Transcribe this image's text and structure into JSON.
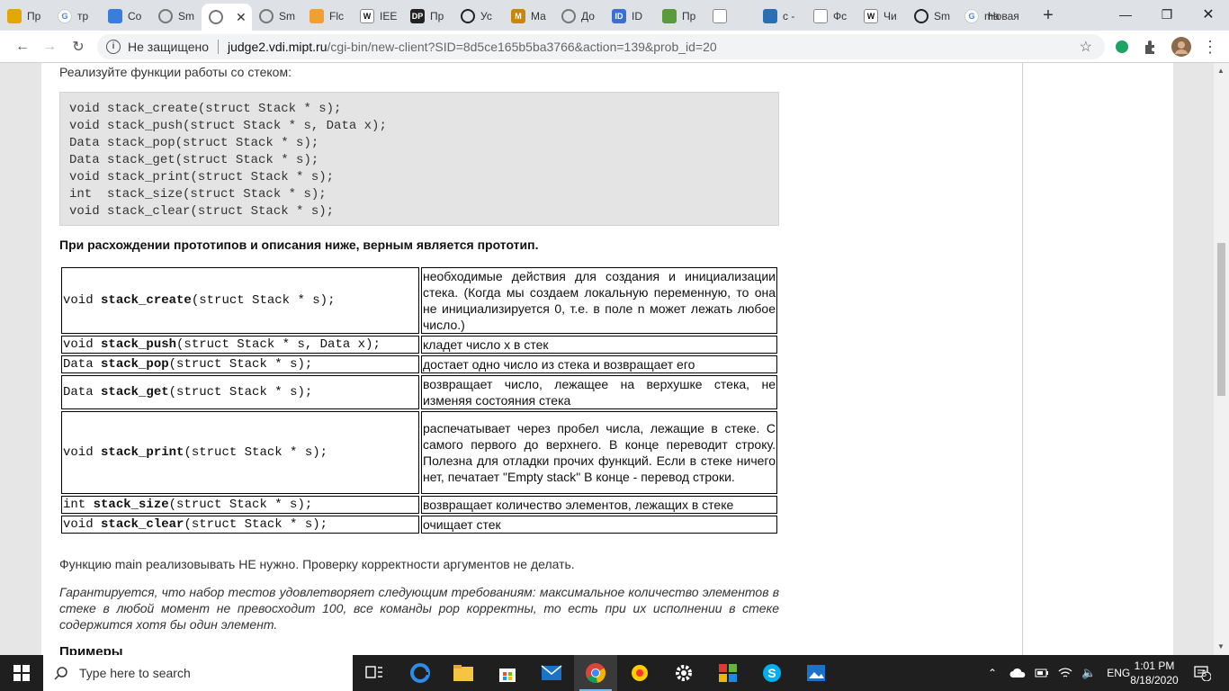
{
  "tabs": [
    {
      "label": "Пр",
      "icon": "yellow-page-icon",
      "color": "#e0a800"
    },
    {
      "label": "тр",
      "icon": "google-icon",
      "color": "#4285f4"
    },
    {
      "label": "Co",
      "icon": "chat-icon",
      "color": "#3b7ddd"
    },
    {
      "label": "Sm",
      "icon": "globe-icon",
      "color": "#777777"
    },
    {
      "label": "",
      "icon": "globe-icon",
      "color": "#777777",
      "active": true
    },
    {
      "label": "Sm",
      "icon": "globe-icon",
      "color": "#777777"
    },
    {
      "label": "Flc",
      "icon": "flowchart-icon",
      "color": "#f0a030"
    },
    {
      "label": "IEE",
      "icon": "wikipedia-icon",
      "color": "#222222"
    },
    {
      "label": "Пр",
      "icon": "dp-icon",
      "color": "#222222"
    },
    {
      "label": "Ус",
      "icon": "globe-icon",
      "color": "#222222"
    },
    {
      "label": "Ма",
      "icon": "m-icon",
      "color": "#c8860a"
    },
    {
      "label": "До",
      "icon": "globe-icon",
      "color": "#777777"
    },
    {
      "label": "ID",
      "icon": "id-icon",
      "color": "#3b6fd0"
    },
    {
      "label": "Пр",
      "icon": "book-icon",
      "color": "#5a9a3a"
    },
    {
      "label": "",
      "icon": "doc-icon",
      "color": "#444444"
    },
    {
      "label": "с -",
      "icon": "stack-icon",
      "color": "#2a6fb5"
    },
    {
      "label": "Фс",
      "icon": "doc-icon",
      "color": "#444444"
    },
    {
      "label": "Чи",
      "icon": "wikipedia-icon",
      "color": "#222222"
    },
    {
      "label": "Sm",
      "icon": "globe-icon",
      "color": "#222222"
    },
    {
      "label": "ma",
      "icon": "google-icon",
      "color": "#4285f4"
    },
    {
      "label": "Новая",
      "icon": "",
      "color": ""
    }
  ],
  "address": {
    "insecure_label": "Не защищено",
    "host": "judge2.vdi.mipt.ru",
    "path": "/cgi-bin/new-client?SID=8d5ce165b5ba3766&action=139&prob_id=20"
  },
  "page": {
    "intro": "Реализуйте функции работы со стеком:",
    "code_lines": [
      "void stack_create(struct Stack * s);",
      "void stack_push(struct Stack * s, Data x);",
      "Data stack_pop(struct Stack * s);",
      "Data stack_get(struct Stack * s);",
      "void stack_print(struct Stack * s);",
      "int  stack_size(struct Stack * s);",
      "void stack_clear(struct Stack * s);"
    ],
    "note": "При расхождении прототипов и описания ниже, верным является прототип.",
    "functions": [
      {
        "ret": "void ",
        "name": "stack_create",
        "args": "(struct Stack * s);",
        "desc": "необходимые действия для создания и инициализации стека. (Когда мы создаем локальную переменную, то она не инициализируется 0, т.е. в поле n может лежать любое число.)"
      },
      {
        "ret": "void ",
        "name": "stack_push",
        "args": "(struct Stack * s, Data x);",
        "desc": "кладет число x в стек"
      },
      {
        "ret": "Data ",
        "name": "stack_pop",
        "args": "(struct Stack * s);",
        "desc": "достает одно число из стека и возвращает его"
      },
      {
        "ret": "Data ",
        "name": "stack_get",
        "args": "(struct Stack * s);",
        "desc": "возвращает число, лежащее на верхушке стека, не изменяя состояния стека"
      },
      {
        "ret": "void ",
        "name": "stack_print",
        "args": "(struct Stack * s);",
        "desc": "распечатывает через пробел числа, лежащие в стеке. С самого первого до верхнего. В конце переводит строку. Полезна для отладки прочих функций. Если в стеке ничего нет, печатает \"Empty stack\" В конце - перевод строки."
      },
      {
        "ret": "int ",
        "name": "stack_size",
        "args": "(struct Stack * s);",
        "desc": "возвращает количество элементов, лежащих в стеке"
      },
      {
        "ret": "void ",
        "name": "stack_clear",
        "args": "(struct Stack * s);",
        "desc": "очищает стек"
      }
    ],
    "main_note": "Функцию main реализовывать НЕ нужно. Проверку корректности аргументов не делать.",
    "guarantee": "Гарантируется, что набор тестов удовлетворяет следующим требованиям: максимальное количество элементов в стеке в любой момент не превосходит 100, все команды pop корректны, то есть при их исполнении в стеке содержится хотя бы один элемент.",
    "examples_heading": "Примеры"
  },
  "taskbar": {
    "search_placeholder": "Type here to search",
    "language": "ENG",
    "time": "1:01 PM",
    "date": "8/18/2020",
    "notifications": "5"
  }
}
